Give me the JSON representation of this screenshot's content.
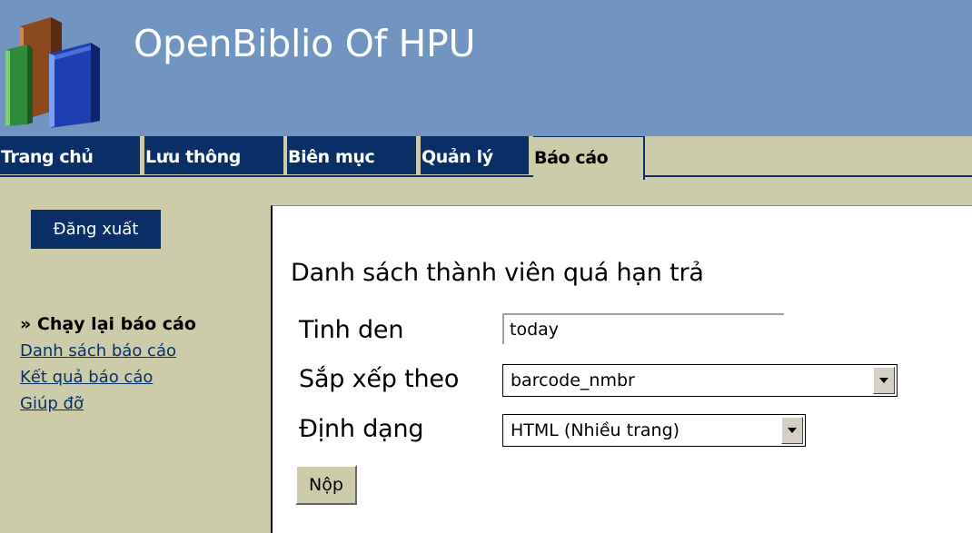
{
  "header": {
    "title": "OpenBiblio Of HPU",
    "logo_icon": "books-icon"
  },
  "tabs": [
    {
      "label": "Trang chủ",
      "active": false
    },
    {
      "label": "Lưu thông",
      "active": false
    },
    {
      "label": "Biên mục",
      "active": false
    },
    {
      "label": "Quản lý",
      "active": false
    },
    {
      "label": "Báo cáo",
      "active": true
    }
  ],
  "sidebar": {
    "logout_label": "Đăng xuất",
    "current_item": "» Chạy lại báo cáo",
    "links": [
      "Danh sách báo cáo",
      "Kết quả báo cáo",
      "Giúp đỡ"
    ]
  },
  "report": {
    "title": "Danh sách thành viên quá hạn trả",
    "date_label": "Tinh den",
    "date_value": "today",
    "sort_label": "Sắp xếp theo",
    "sort_value": "barcode_nmbr",
    "format_label": "Định dạng",
    "format_value": "HTML (Nhiều trang)",
    "submit_label": "Nộp"
  },
  "colors": {
    "banner": "#7294c1",
    "tab_bg": "#0a2f66",
    "page_bg": "#ccccaa",
    "panel_bg": "#ffffff"
  }
}
